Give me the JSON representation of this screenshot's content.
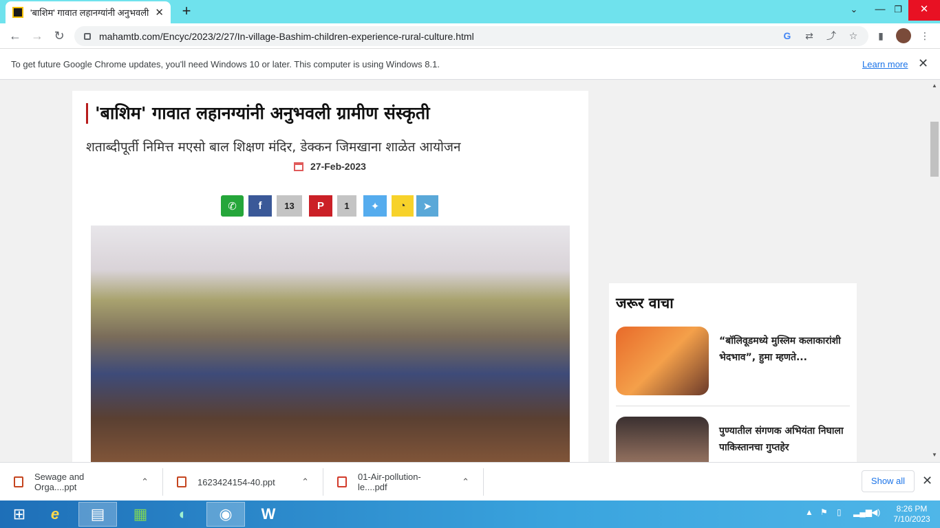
{
  "browser": {
    "tab_title": "'बाशिम' गावात लहानग्यांनी अनुभवली",
    "url": "mahamtb.com/Encyc/2023/2/27/In-village-Bashim-children-experience-rural-culture.html",
    "window_controls": {
      "minimize": "—",
      "restore": "❐",
      "close": "✕"
    }
  },
  "infobar": {
    "message": "To get future Google Chrome updates, you'll need Windows 10 or later. This computer is using Windows 8.1.",
    "link": "Learn more"
  },
  "article": {
    "headline": "'बाशिम' गावात लहानग्यांनी अनुभवली ग्रामीण संस्कृती",
    "subtitle": "शताब्दीपूर्ती निमित्त मएसो बाल शिक्षण मंदिर, डेक्कन जिमखाना शाळेत आयोजन",
    "date": "27-Feb-2023",
    "share": {
      "facebook_count": "13",
      "pinterest_count": "1"
    }
  },
  "sidebar": {
    "title": "जरूर वाचा",
    "items": [
      {
        "text": "“बॉलिवूडमध्ये मुस्लिम कलाकारांशी भेदभाव”, हुमा म्हणते..."
      },
      {
        "text": "पुण्यातील संगणक अभियंता निघाला पाकिस्तानचा गुप्तहेर"
      }
    ]
  },
  "downloads": {
    "items": [
      {
        "name": "Sewage and Orga....ppt"
      },
      {
        "name": "1623424154-40.ppt"
      },
      {
        "name": "01-Air-pollution-le....pdf"
      }
    ],
    "show_all": "Show all"
  },
  "taskbar": {
    "time": "8:26 PM",
    "date": "7/10/2023"
  },
  "colors": {
    "tabstrip": "#6fe2ed",
    "accent": "#1a73e8",
    "headline_bar": "#b71c1c"
  }
}
